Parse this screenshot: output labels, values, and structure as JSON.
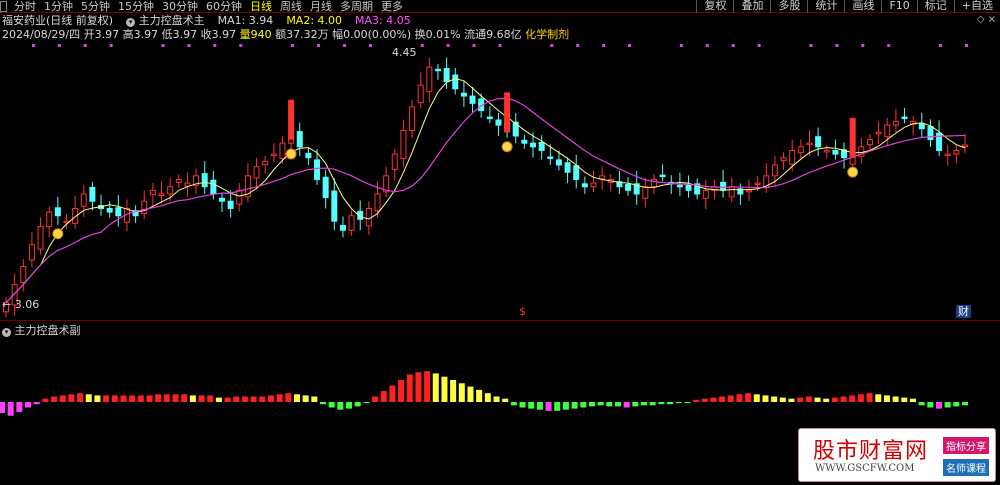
{
  "toolbar": {
    "timeframes": [
      {
        "label": "分时",
        "active": false
      },
      {
        "label": "1分钟",
        "active": false
      },
      {
        "label": "5分钟",
        "active": false
      },
      {
        "label": "15分钟",
        "active": false
      },
      {
        "label": "30分钟",
        "active": false
      },
      {
        "label": "60分钟",
        "active": false
      },
      {
        "label": "日线",
        "active": true
      },
      {
        "label": "周线",
        "active": false
      },
      {
        "label": "月线",
        "active": false
      },
      {
        "label": "多周期",
        "active": false
      },
      {
        "label": "更多",
        "active": false
      }
    ],
    "right_buttons": [
      "复权",
      "叠加",
      "多股",
      "统计",
      "画线",
      "F10",
      "标记",
      "+自选"
    ]
  },
  "info": {
    "stock_name": "福安药业(日线 前复权)",
    "indicator_name": "主力控盘术主",
    "ma1": "MA1: 3.94",
    "ma2": "MA2: 4.00",
    "ma3": "MA3: 4.05",
    "date": "2024/08/29/四",
    "open": "开3.97",
    "high": "高3.97",
    "low": "低3.97",
    "close": "收3.97",
    "volume": "量940",
    "amount": "额37.32万",
    "change": "幅0.00(0.00%)",
    "turnover": "换0.01%",
    "float": "流通9.68亿",
    "sector": "化学制剂"
  },
  "chart_labels": {
    "high_price": "4.45",
    "low_price": "3.06",
    "cai_badge": "财",
    "dollar": "$"
  },
  "sub_indicator": {
    "name": "主力控盘术副"
  },
  "watermark": {
    "title": "股市财富网",
    "url": "WWW.GSCFW.COM",
    "tag1": "指标分享",
    "tag2": "名师课程"
  },
  "colors": {
    "up": "#ff3232",
    "down": "#54ffff",
    "ma_short": "#ffff80",
    "ma_long": "#e040e0",
    "hist_red": "#ff2020",
    "hist_yellow": "#ffff40",
    "hist_green": "#40ff40",
    "hist_magenta": "#ff40ff"
  },
  "chart_data": {
    "type": "candlestick",
    "price_labels": {
      "high": 4.45,
      "low": 3.06
    },
    "closes": [
      3.1,
      3.2,
      3.3,
      3.42,
      3.52,
      3.6,
      3.58,
      3.55,
      3.62,
      3.7,
      3.66,
      3.62,
      3.6,
      3.58,
      3.62,
      3.58,
      3.66,
      3.72,
      3.7,
      3.74,
      3.78,
      3.76,
      3.8,
      3.74,
      3.7,
      3.66,
      3.62,
      3.72,
      3.8,
      3.85,
      3.88,
      3.92,
      3.98,
      4.02,
      3.96,
      3.9,
      3.78,
      3.68,
      3.55,
      3.5,
      3.58,
      3.56,
      3.62,
      3.7,
      3.8,
      3.92,
      4.05,
      4.18,
      4.3,
      4.4,
      4.38,
      4.32,
      4.28,
      4.24,
      4.2,
      4.16,
      4.12,
      4.08,
      4.06,
      4.02,
      3.98,
      3.96,
      3.94,
      3.9,
      3.86,
      3.82,
      3.78,
      3.74,
      3.76,
      3.8,
      3.78,
      3.74,
      3.72,
      3.7,
      3.74,
      3.78,
      3.8,
      3.76,
      3.74,
      3.72,
      3.7,
      3.72,
      3.74,
      3.72,
      3.74,
      3.7,
      3.72,
      3.76,
      3.8,
      3.86,
      3.9,
      3.94,
      3.96,
      3.98,
      3.96,
      3.94,
      3.92,
      3.9,
      3.92,
      3.96,
      4.0,
      4.04,
      4.08,
      4.1,
      4.12,
      4.1,
      4.06,
      4.0,
      3.94,
      3.92,
      3.94,
      3.97
    ],
    "histogram": [
      -20,
      -25,
      -18,
      -10,
      -4,
      6,
      10,
      12,
      14,
      16,
      14,
      12,
      12,
      12,
      12,
      12,
      12,
      12,
      14,
      14,
      14,
      14,
      12,
      12,
      12,
      8,
      8,
      10,
      10,
      10,
      10,
      12,
      14,
      16,
      14,
      12,
      10,
      -4,
      -10,
      -14,
      -12,
      -8,
      -2,
      10,
      20,
      30,
      40,
      50,
      54,
      56,
      52,
      46,
      40,
      34,
      28,
      22,
      16,
      10,
      6,
      -6,
      -10,
      -12,
      -14,
      -16,
      -16,
      -14,
      -12,
      -10,
      -8,
      -6,
      -8,
      -8,
      -10,
      -8,
      -6,
      -6,
      -4,
      -4,
      -2,
      -2,
      4,
      6,
      8,
      10,
      12,
      14,
      16,
      14,
      12,
      10,
      8,
      6,
      8,
      10,
      8,
      6,
      8,
      10,
      12,
      14,
      16,
      14,
      12,
      10,
      8,
      6,
      -6,
      -10,
      -12,
      -10,
      -8,
      -6
    ]
  }
}
